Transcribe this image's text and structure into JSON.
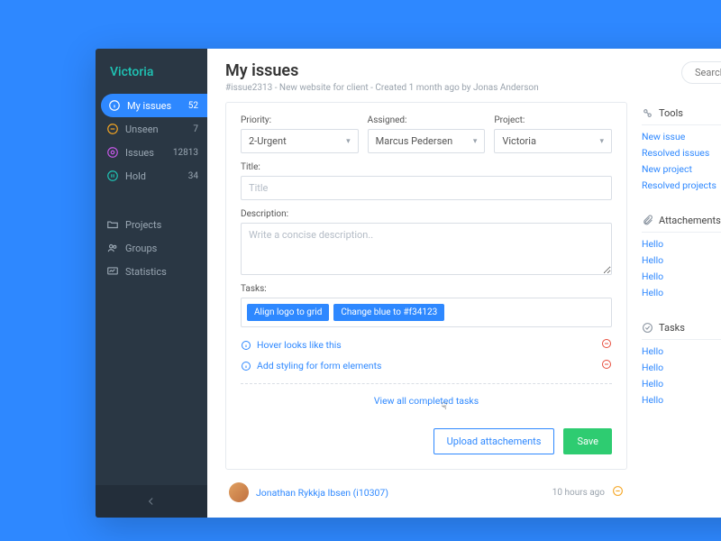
{
  "brand": "Victoria",
  "search": {
    "placeholder": "Search"
  },
  "nav": {
    "primary": [
      {
        "label": "My issues",
        "count": "52",
        "icon": "info",
        "color": "#ffffff",
        "active": true
      },
      {
        "label": "Unseen",
        "count": "7",
        "icon": "dash",
        "color": "#f5a623"
      },
      {
        "label": "Issues",
        "count": "12813",
        "icon": "target",
        "color": "#c658e8"
      },
      {
        "label": "Hold",
        "count": "34",
        "icon": "pause",
        "color": "#1fc4b5"
      }
    ],
    "secondary": [
      {
        "label": "Projects",
        "icon": "folder"
      },
      {
        "label": "Groups",
        "icon": "group"
      },
      {
        "label": "Statistics",
        "icon": "chart"
      }
    ]
  },
  "header": {
    "title": "My issues",
    "subtitle": "#issue2313 - New website for client - Created 1 month ago by Jonas Anderson"
  },
  "form": {
    "priority_label": "Priority:",
    "priority_value": "2-Urgent",
    "assigned_label": "Assigned:",
    "assigned_value": "Marcus Pedersen",
    "project_label": "Project:",
    "project_value": "Victoria",
    "title_label": "Title:",
    "title_placeholder": "Title",
    "description_label": "Description:",
    "description_placeholder": "Write a concise description..",
    "tasks_label": "Tasks:",
    "task_chips": [
      "Align logo to grid",
      "Change blue to #f34123"
    ],
    "task_lines": [
      "Hover looks like this",
      "Add styling for form elements"
    ],
    "view_all": "View all completed tasks",
    "upload_btn": "Upload attachements",
    "save_btn": "Save"
  },
  "comment": {
    "name": "Jonathan Rykkja Ibsen (i10307)",
    "time": "10 hours ago"
  },
  "rail": {
    "tools": {
      "title": "Tools",
      "links": [
        "New issue",
        "Resolved issues",
        "New project",
        "Resolved projects"
      ]
    },
    "attachments": {
      "title": "Attachements",
      "links": [
        "Hello",
        "Hello",
        "Hello",
        "Hello"
      ]
    },
    "tasks": {
      "title": "Tasks",
      "links": [
        "Hello",
        "Hello",
        "Hello",
        "Hello"
      ]
    }
  }
}
